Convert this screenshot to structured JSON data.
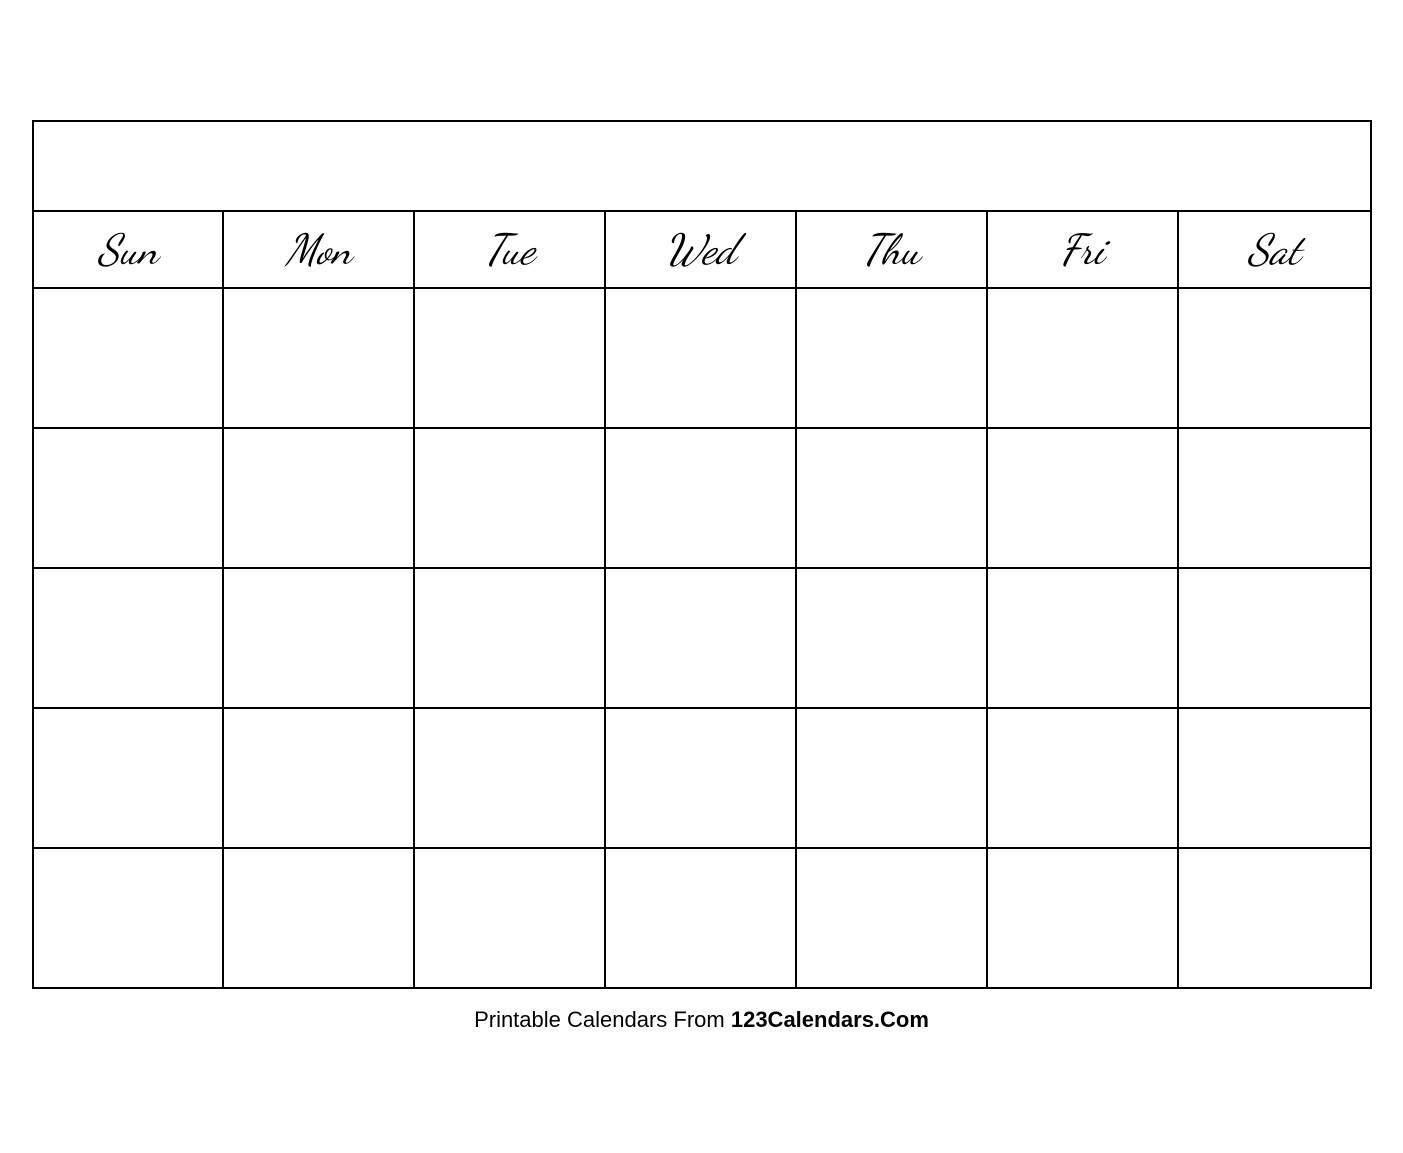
{
  "calendar": {
    "title": "",
    "days": [
      "Sun",
      "Mon",
      "Tue",
      "Wed",
      "Thu",
      "Fri",
      "Sat"
    ],
    "rows": 5
  },
  "footer": {
    "text_normal": "Printable Calendars From ",
    "text_bold": "123Calendars.Com"
  }
}
